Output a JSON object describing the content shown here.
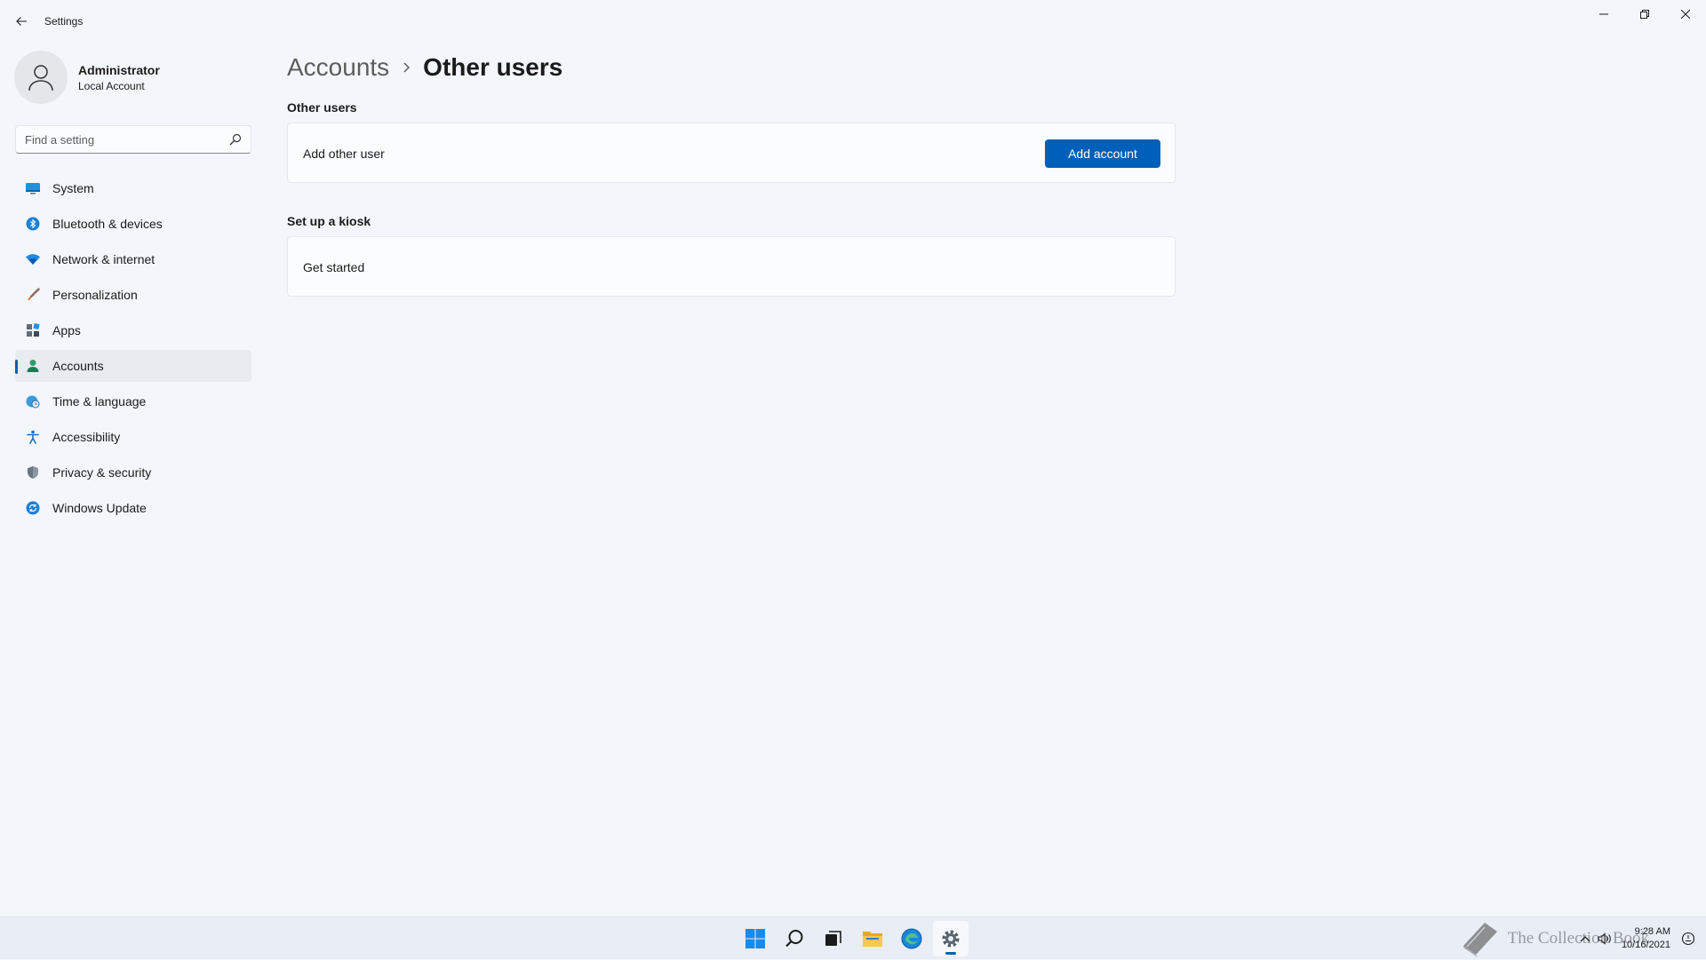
{
  "window": {
    "title": "Settings"
  },
  "profile": {
    "name": "Administrator",
    "account_type": "Local Account"
  },
  "search": {
    "placeholder": "Find a setting"
  },
  "sidebar": {
    "items": [
      {
        "label": "System",
        "icon": "monitor-icon"
      },
      {
        "label": "Bluetooth & devices",
        "icon": "bluetooth-icon"
      },
      {
        "label": "Network & internet",
        "icon": "wifi-icon"
      },
      {
        "label": "Personalization",
        "icon": "brush-icon"
      },
      {
        "label": "Apps",
        "icon": "apps-icon"
      },
      {
        "label": "Accounts",
        "icon": "person-icon",
        "active": true
      },
      {
        "label": "Time & language",
        "icon": "globe-clock-icon"
      },
      {
        "label": "Accessibility",
        "icon": "accessibility-icon"
      },
      {
        "label": "Privacy & security",
        "icon": "shield-icon"
      },
      {
        "label": "Windows Update",
        "icon": "update-icon"
      }
    ]
  },
  "breadcrumb": {
    "parent": "Accounts",
    "current": "Other users"
  },
  "sections": {
    "other_users": {
      "title": "Other users",
      "card_label": "Add other user",
      "button_label": "Add account"
    },
    "kiosk": {
      "title": "Set up a kiosk",
      "card_label": "Get started"
    }
  },
  "taskbar": {
    "time": "9:28 AM",
    "date": "10/16/2021",
    "watermark_text": "The Collection Book"
  },
  "colors": {
    "accent": "#005fb8",
    "background": "#f3f6fb",
    "card": "#fbfcfd"
  }
}
